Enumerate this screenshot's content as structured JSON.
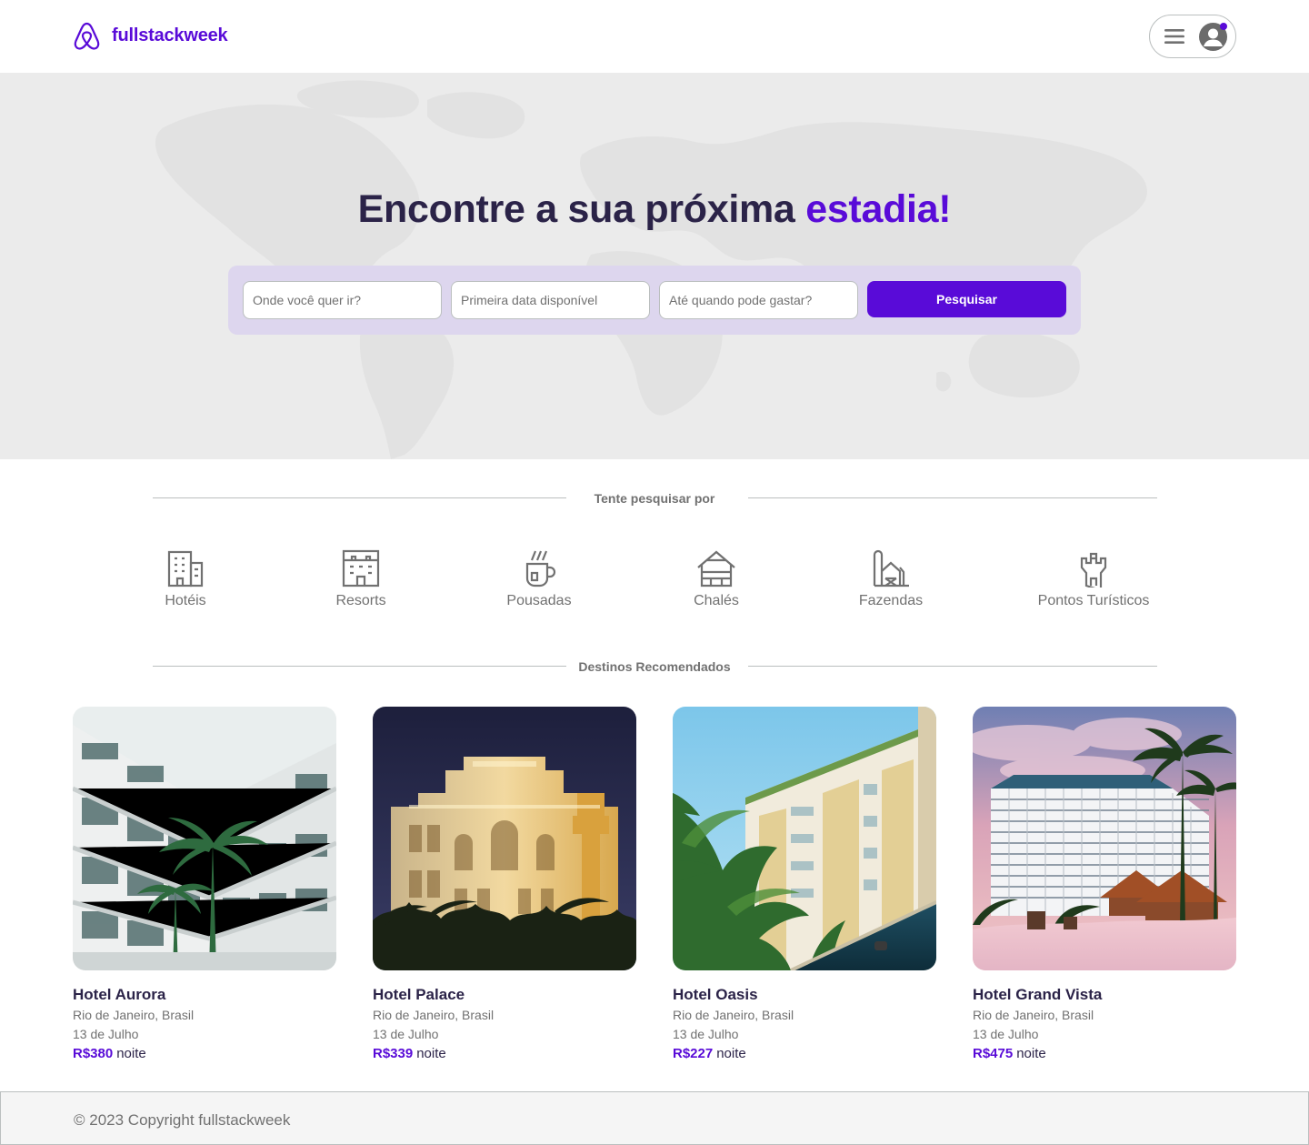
{
  "brand": {
    "name": "fullstackweek",
    "color": "#590bd8"
  },
  "header": {
    "menu_icon": "hamburger-icon",
    "avatar_icon": "user-avatar-icon"
  },
  "hero": {
    "title_main": "Encontre a sua próxima",
    "title_accent": "estadia!",
    "search": {
      "destination_placeholder": "Onde você quer ir?",
      "date_placeholder": "Primeira data disponível",
      "budget_placeholder": "Até quando pode gastar?",
      "button_label": "Pesquisar"
    }
  },
  "categories": {
    "title": "Tente pesquisar por",
    "items": [
      {
        "label": "Hotéis",
        "icon": "hotel-icon"
      },
      {
        "label": "Resorts",
        "icon": "resort-icon"
      },
      {
        "label": "Pousadas",
        "icon": "inn-icon"
      },
      {
        "label": "Chalés",
        "icon": "chalet-icon"
      },
      {
        "label": "Fazendas",
        "icon": "farm-icon"
      },
      {
        "label": "Pontos Turísticos",
        "icon": "tourist-spot-icon"
      }
    ]
  },
  "recommended": {
    "title": "Destinos Recomendados",
    "trips": [
      {
        "name": "Hotel Aurora",
        "location": "Rio de Janeiro, Brasil",
        "date": "13 de Julho",
        "price": "R$380",
        "unit": "noite"
      },
      {
        "name": "Hotel Palace",
        "location": "Rio de Janeiro, Brasil",
        "date": "13 de Julho",
        "price": "R$339",
        "unit": "noite"
      },
      {
        "name": "Hotel Oasis",
        "location": "Rio de Janeiro, Brasil",
        "date": "13 de Julho",
        "price": "R$227",
        "unit": "noite"
      },
      {
        "name": "Hotel Grand Vista",
        "location": "Rio de Janeiro, Brasil",
        "date": "13 de Julho",
        "price": "R$475",
        "unit": "noite"
      }
    ]
  },
  "footer": {
    "copyright": "© 2023 Copyright fullstackweek"
  }
}
